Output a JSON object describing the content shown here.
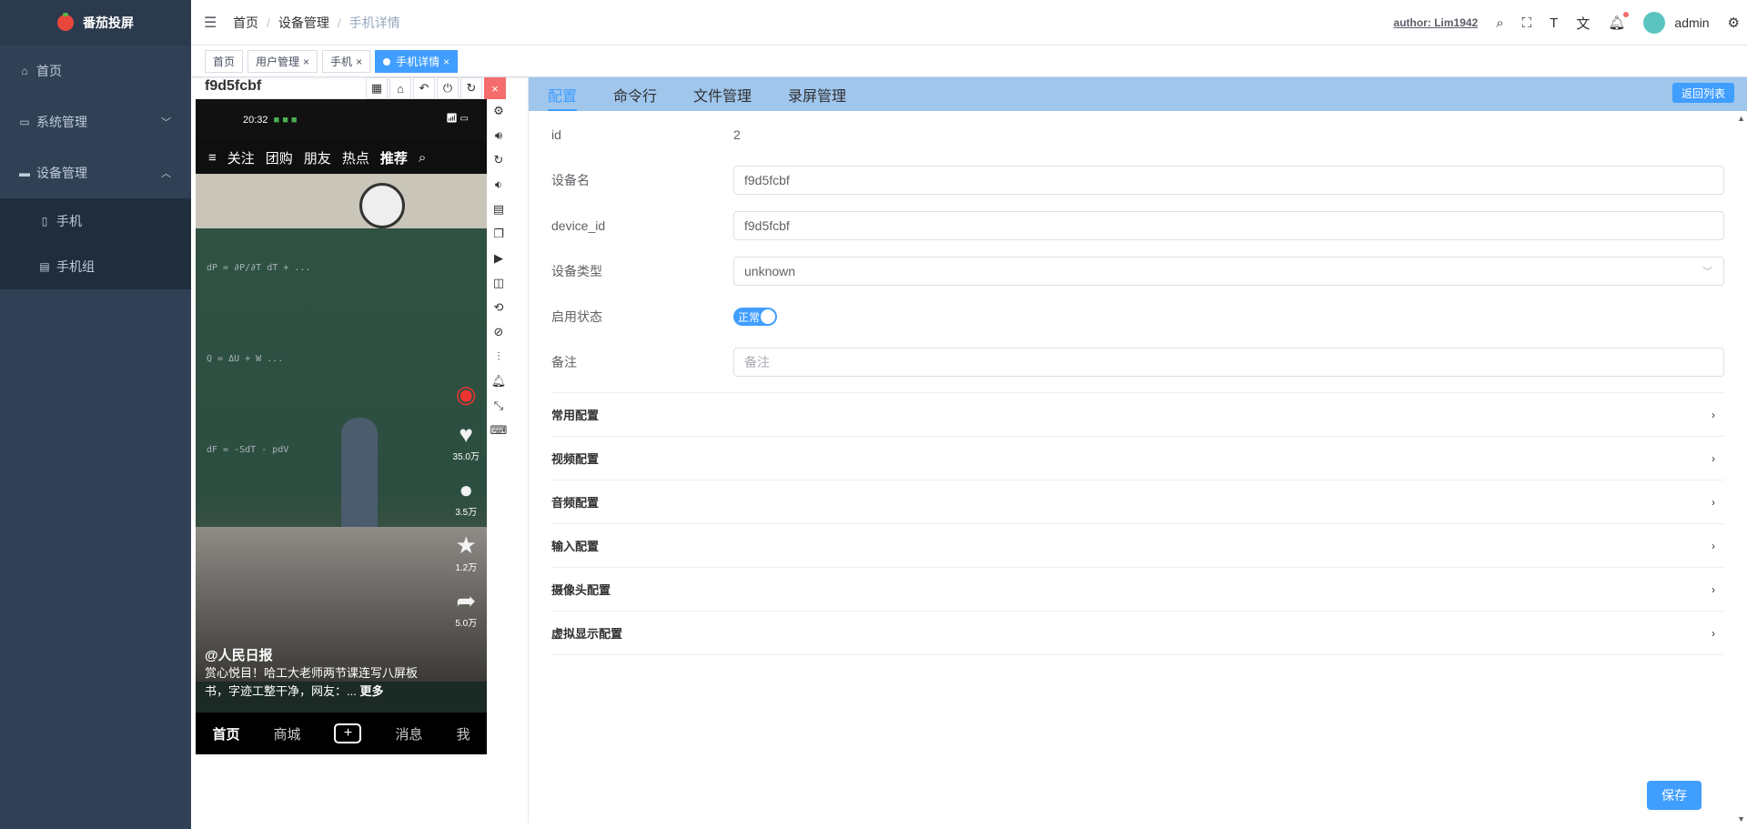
{
  "app": {
    "title": "番茄投屏"
  },
  "sidebar": {
    "items": [
      {
        "label": "首页",
        "icon": "home-icon"
      },
      {
        "label": "系统管理",
        "icon": "monitor-icon",
        "arrow": "﹀"
      },
      {
        "label": "设备管理",
        "icon": "device-icon",
        "arrow": "︿"
      }
    ],
    "sub_items": [
      {
        "label": "手机",
        "icon": "phone-icon"
      },
      {
        "label": "手机组",
        "icon": "phone-group-icon"
      }
    ]
  },
  "header": {
    "breadcrumb": [
      "首页",
      "设备管理",
      "手机详情"
    ],
    "author": "author: Lim1942",
    "username": "admin"
  },
  "tags": [
    {
      "label": "首页",
      "closable": false,
      "active": false
    },
    {
      "label": "用户管理",
      "closable": true,
      "active": false
    },
    {
      "label": "手机",
      "closable": true,
      "active": false
    },
    {
      "label": "手机详情",
      "closable": true,
      "active": true
    }
  ],
  "phone": {
    "title": "f9d5fcbf",
    "screen": {
      "time": "20:32",
      "top_nav": [
        "关注",
        "团购",
        "朋友",
        "热点",
        "推荐"
      ],
      "likes": "35.0万",
      "comments": "3.5万",
      "favorites": "1.2万",
      "shares": "5.0万",
      "author": "@人民日报",
      "caption": "赏心悦目！哈工大老师两节课连写八屏板书，字迹工整干净，网友：...",
      "more": "更多",
      "bottom_nav": [
        "首页",
        "商城",
        "消息",
        "我"
      ]
    }
  },
  "main": {
    "tabs": [
      "配置",
      "命令行",
      "文件管理",
      "录屏管理"
    ],
    "back_button": "返回列表",
    "form": {
      "id_label": "id",
      "id_value": "2",
      "name_label": "设备名",
      "name_value": "f9d5fcbf",
      "device_id_label": "device_id",
      "device_id_value": "f9d5fcbf",
      "type_label": "设备类型",
      "type_value": "unknown",
      "status_label": "启用状态",
      "status_value": "正常",
      "remark_label": "备注",
      "remark_placeholder": "备注"
    },
    "sections": [
      "常用配置",
      "视频配置",
      "音频配置",
      "输入配置",
      "摄像头配置",
      "虚拟显示配置"
    ],
    "save_button": "保存"
  },
  "colors": {
    "primary": "#409eff",
    "sidebar": "#304156",
    "tabbar": "#a0c6ec",
    "danger": "#f56c6c"
  }
}
